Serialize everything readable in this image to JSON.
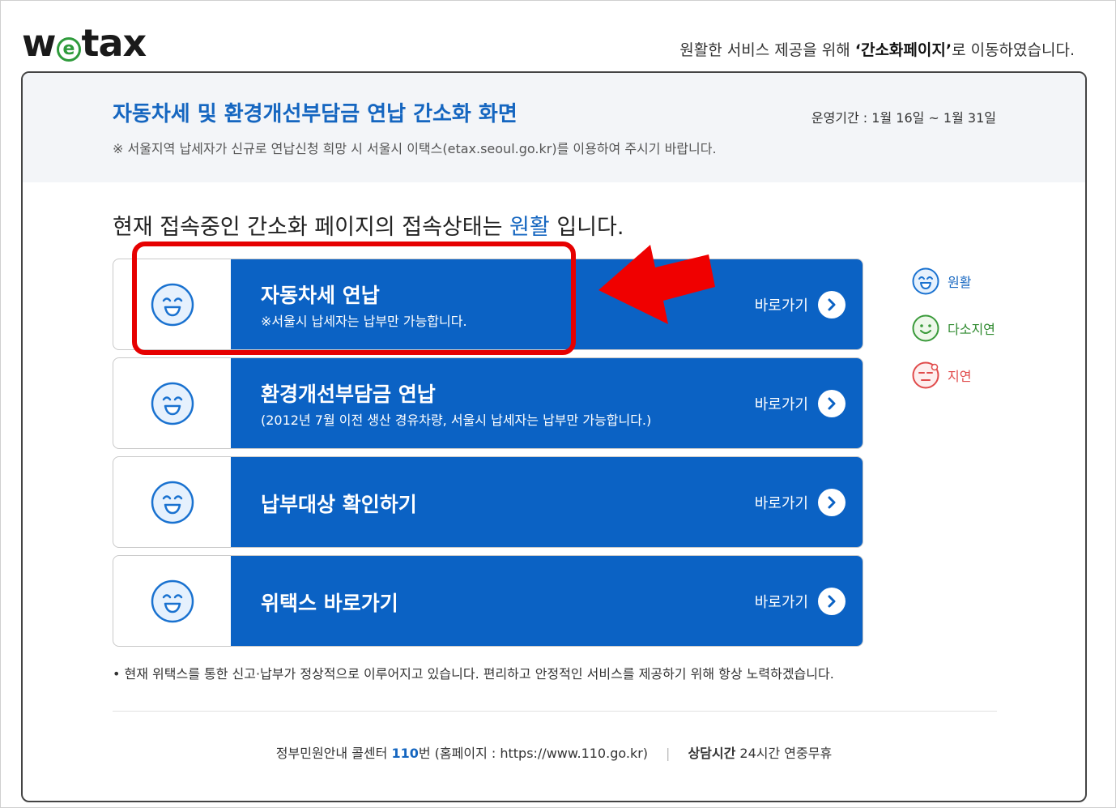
{
  "logo": {
    "text_pre": "w",
    "text_mid": "e",
    "text_post": "tax"
  },
  "top_notice": {
    "pre": "원활한 서비스 제공을 위해 ",
    "bold": "‘간소화페이지’",
    "post": "로 이동하였습니다."
  },
  "header": {
    "title": "자동차세 및 환경개선부담금 연납 간소화 화면",
    "note": "※ 서울지역 납세자가 신규로 연납신청 희망 시 서울시 이택스(etax.seoul.go.kr)를 이용하여 주시기 바랍니다.",
    "period": "운영기간 : 1월 16일 ~ 1월 31일"
  },
  "status": {
    "pre": "현재 접속중인 간소화 페이지의 접속상태는 ",
    "value": "원활",
    "post": " 입니다."
  },
  "cards": [
    {
      "title": "자동차세 연납",
      "desc": "※서울시 납세자는 납부만 가능합니다.",
      "go": "바로가기"
    },
    {
      "title": "환경개선부담금 연납",
      "desc": "(2012년 7월 이전 생산 경유차량, 서울시 납세자는 납부만 가능합니다.)",
      "go": "바로가기"
    },
    {
      "title": "납부대상 확인하기",
      "desc": "",
      "go": "바로가기"
    },
    {
      "title": "위택스 바로가기",
      "desc": "",
      "go": "바로가기"
    }
  ],
  "legend": [
    {
      "label": "원활",
      "color": "#1566c0",
      "icon": "smile-face-icon"
    },
    {
      "label": "다소지연",
      "color": "#3a9a3a",
      "icon": "neutral-smile-face-icon"
    },
    {
      "label": "지연",
      "color": "#e04a4a",
      "icon": "sad-face-icon"
    }
  ],
  "bullet_note": "•   현재 위택스를 통한 신고·납부가 정상적으로 이루어지고 있습니다. 편리하고 안정적인 서비스를 제공하기 위해 항상 노력하겠습니다.",
  "footer": {
    "callcenter_pre": "정부민원안내 콜센터 ",
    "callcenter_num": "110",
    "callcenter_post": "번 (홈페이지 : https://www.110.go.kr)",
    "separator": "|",
    "hours_label": "상담시간",
    "hours_value": " 24시간 연중무휴"
  },
  "colors": {
    "brand_blue": "#0b62c4",
    "title_blue": "#1566c0",
    "highlight_red": "#e60000"
  }
}
